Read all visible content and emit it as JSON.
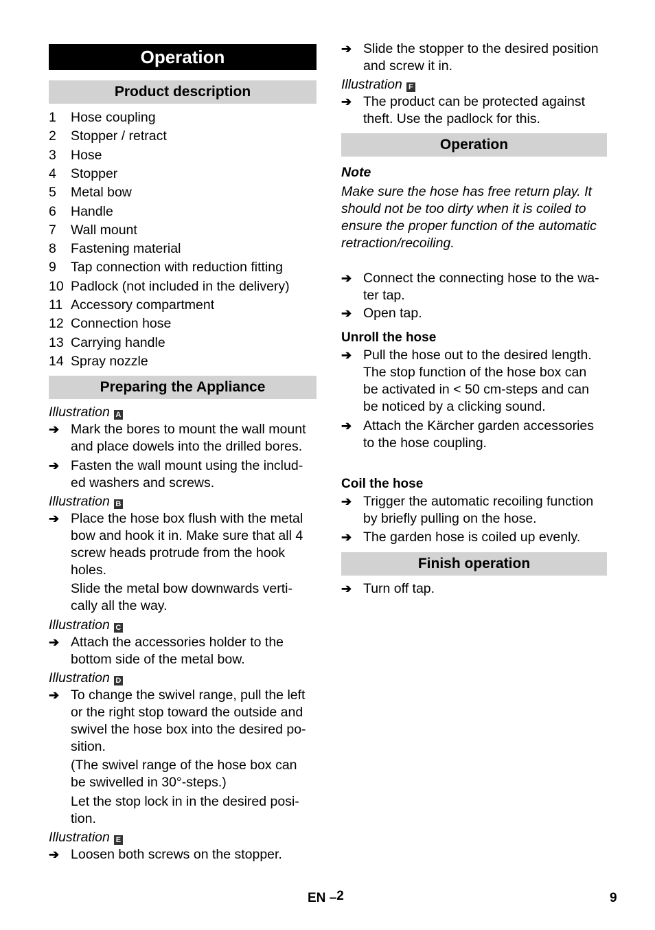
{
  "page": {
    "title": "Operation",
    "footer": {
      "lang": "EN",
      "sep": "–",
      "section_page": "2",
      "page_number": "9"
    }
  },
  "left": {
    "product_description": {
      "heading": "Product description",
      "items": [
        {
          "n": "1",
          "label": "Hose coupling"
        },
        {
          "n": "2",
          "label": "Stopper / retract"
        },
        {
          "n": "3",
          "label": "Hose"
        },
        {
          "n": "4",
          "label": "Stopper"
        },
        {
          "n": "5",
          "label": "Metal bow"
        },
        {
          "n": "6",
          "label": "Handle"
        },
        {
          "n": "7",
          "label": "Wall mount"
        },
        {
          "n": "8",
          "label": "Fastening material"
        },
        {
          "n": "9",
          "label": "Tap connection with reduction fitting"
        },
        {
          "n": "10",
          "label": "Padlock (not included in the delivery)"
        },
        {
          "n": "11",
          "label": "Accessory compartment"
        },
        {
          "n": "12",
          "label": "Connection hose"
        },
        {
          "n": "13",
          "label": "Carrying handle"
        },
        {
          "n": "14",
          "label": "Spray nozzle"
        }
      ]
    },
    "preparing": {
      "heading": "Preparing the Appliance",
      "illustration_label": "Illustration",
      "ill_a": "A",
      "a1": [
        "Mark the bores to mount the wall mount",
        "and place dowels into the drilled bores."
      ],
      "a2": [
        "Fasten the wall mount using the includ-",
        "ed washers and screws."
      ],
      "ill_b": "B",
      "b1": [
        "Place the hose box flush with the metal",
        "bow and hook it in. Make sure that all 4",
        "screw heads protrude from the hook",
        "holes."
      ],
      "b1_cont": [
        "Slide the metal bow downwards verti-",
        "cally all the way."
      ],
      "ill_c": "C",
      "c1": [
        "Attach the accessories holder to the",
        "bottom side of the metal bow."
      ],
      "ill_d": "D",
      "d1": [
        "To change the swivel range, pull the left",
        "or the right stop toward the outside and",
        "swivel the hose box into the desired po-",
        "sition."
      ],
      "d1_cont1": [
        "(The swivel range of the hose box can",
        "be swivelled in 30°-steps.)"
      ],
      "d1_cont2": [
        "Let the stop lock in in the desired posi-",
        "tion."
      ],
      "ill_e": "E",
      "e1": [
        "Loosen both screws on the stopper."
      ]
    }
  },
  "right": {
    "e2": [
      "Slide the stopper to the desired position",
      "and screw it in."
    ],
    "illustration_label": "Illustration",
    "ill_f": "F",
    "f1": [
      "The product can be protected against",
      "theft. Use the padlock for this."
    ],
    "operation": {
      "heading": "Operation",
      "note_heading": "Note",
      "note": [
        "Make sure the hose has free return play. It",
        "should not be too dirty when it is coiled to",
        "ensure the proper function of the automatic",
        "retraction/recoiling."
      ],
      "s1": [
        "Connect the connecting hose to the wa-",
        "ter tap."
      ],
      "s2": [
        "Open tap."
      ],
      "unroll_heading": "Unroll the hose",
      "u1": [
        "Pull the hose out to the desired length.",
        "The stop function of the hose box can",
        "be activated in < 50 cm-steps and can",
        "be noticed by a clicking sound."
      ],
      "u2": [
        "Attach the Kärcher garden accessories",
        "to the hose coupling."
      ],
      "coil_heading": "Coil the hose",
      "c1": [
        "Trigger the automatic recoiling function",
        "by briefly pulling on the hose."
      ],
      "c2": [
        "The garden hose is coiled up evenly."
      ]
    },
    "finish": {
      "heading": "Finish operation",
      "f1": [
        "Turn off tap."
      ]
    }
  },
  "icons": {
    "bullet": "arrow-right-icon",
    "arrow_glyph": "➔"
  }
}
